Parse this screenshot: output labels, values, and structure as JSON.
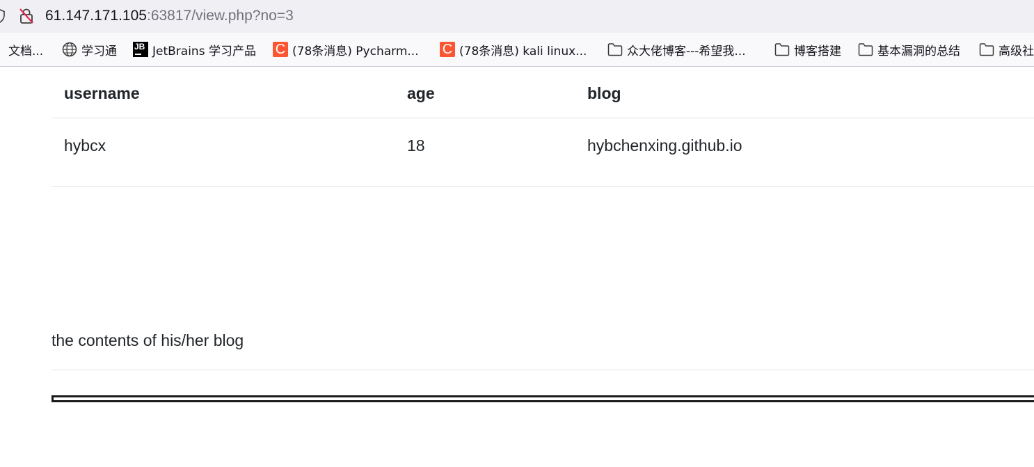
{
  "browser": {
    "url_host": "61.147.171.105",
    "url_path": ":63817/view.php?no=3",
    "icons": {
      "shield": "shield-icon",
      "lock": "insecure-lock-icon"
    }
  },
  "bookmarks": [
    {
      "label": "文档...",
      "icon": "none"
    },
    {
      "label": "学习通",
      "icon": "globe-icon"
    },
    {
      "label": "JetBrains 学习产品",
      "icon": "jetbrains-icon",
      "icon_text": "JB"
    },
    {
      "label": "(78条消息) Pycharm...",
      "icon": "csdn-icon",
      "icon_text": "C"
    },
    {
      "label": "(78条消息) kali linux...",
      "icon": "csdn-icon",
      "icon_text": "C"
    },
    {
      "label": "众大佬博客---希望我...",
      "icon": "folder-icon"
    },
    {
      "label": "博客搭建",
      "icon": "folder-icon"
    },
    {
      "label": "基本漏洞的总结",
      "icon": "folder-icon"
    },
    {
      "label": "高级社",
      "icon": "folder-icon"
    }
  ],
  "table": {
    "headers": [
      "username",
      "age",
      "blog"
    ],
    "rows": [
      [
        "hybcx",
        "18",
        "hybchenxing.github.io"
      ]
    ]
  },
  "blog_caption": "the contents of his/her blog",
  "colors": {
    "urlbar_bg": "#f0f0f4",
    "bookmarks_bg": "#f9f9fb",
    "csdn_accent": "#fc5531",
    "text": "#212529",
    "divider": "#dee2e6"
  }
}
